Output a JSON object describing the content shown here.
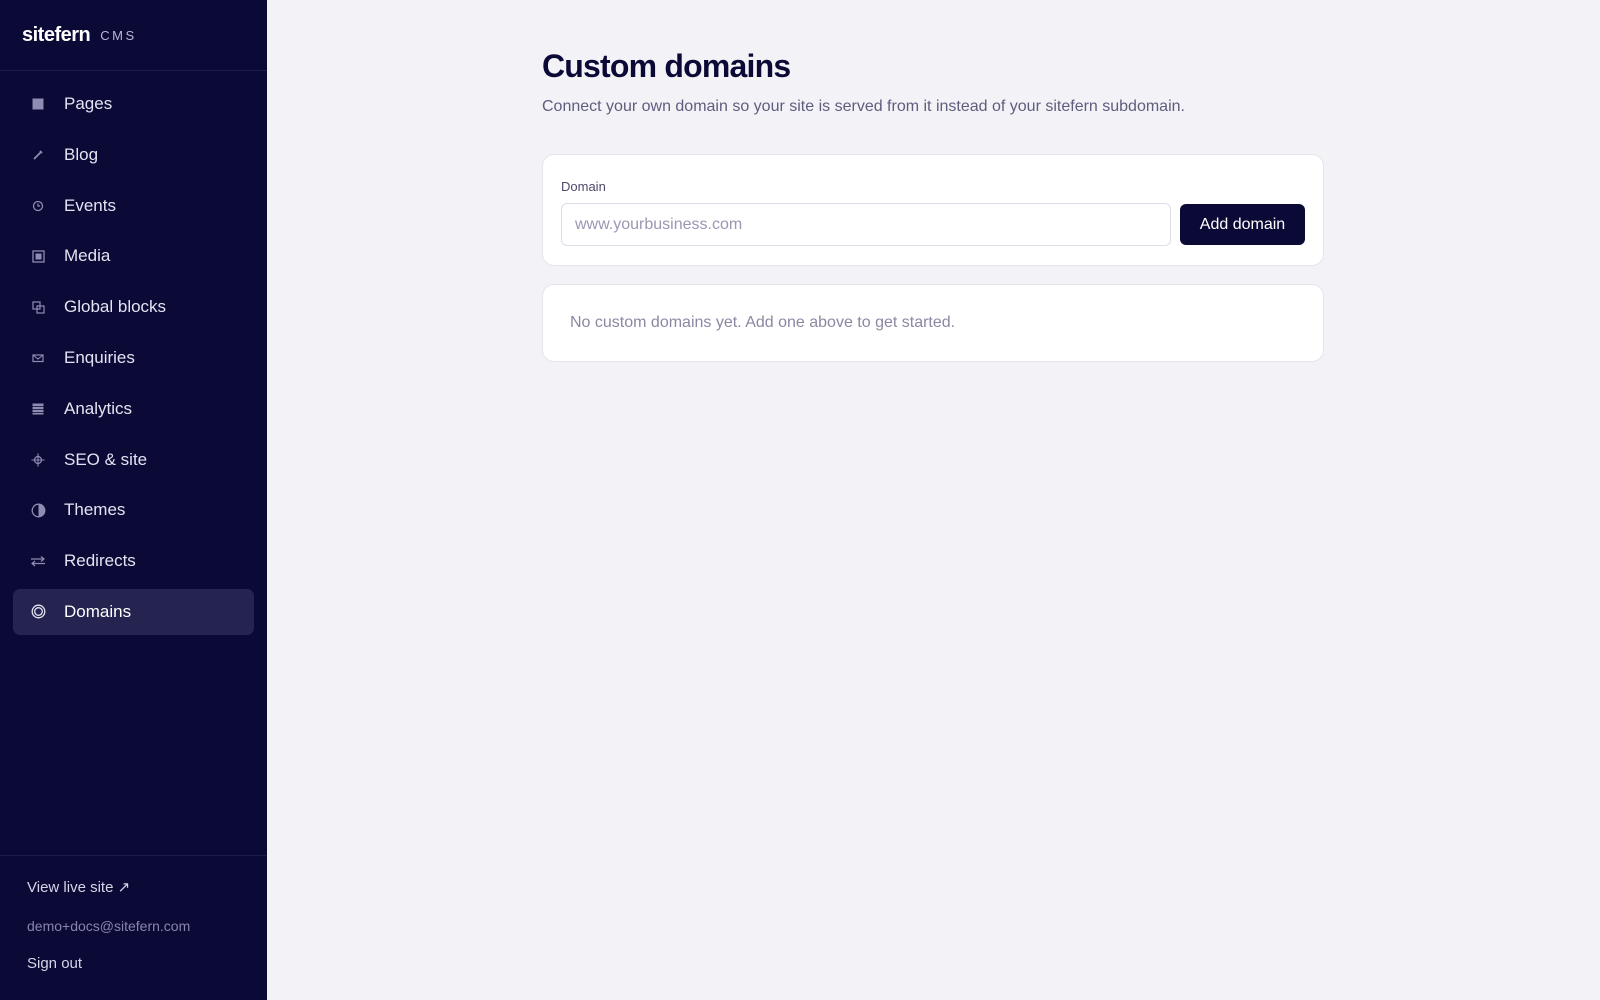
{
  "brand": {
    "name": "sitefern",
    "tag": "CMS"
  },
  "sidebar": {
    "items": [
      {
        "label": "Pages",
        "icon": "pages-icon",
        "active": false
      },
      {
        "label": "Blog",
        "icon": "pencil-icon",
        "active": false
      },
      {
        "label": "Events",
        "icon": "clock-icon",
        "active": false
      },
      {
        "label": "Media",
        "icon": "image-icon",
        "active": false
      },
      {
        "label": "Global blocks",
        "icon": "blocks-icon",
        "active": false
      },
      {
        "label": "Enquiries",
        "icon": "envelope-icon",
        "active": false
      },
      {
        "label": "Analytics",
        "icon": "bar-chart-icon",
        "active": false
      },
      {
        "label": "SEO & site",
        "icon": "crosshair-icon",
        "active": false
      },
      {
        "label": "Themes",
        "icon": "half-circle-icon",
        "active": false
      },
      {
        "label": "Redirects",
        "icon": "arrows-swap-icon",
        "active": false
      },
      {
        "label": "Domains",
        "icon": "globe-ring-icon",
        "active": true
      }
    ],
    "footer": {
      "view_live": "View live site ↗",
      "email": "demo+docs@sitefern.com",
      "sign_out": "Sign out"
    }
  },
  "main": {
    "title": "Custom domains",
    "subtitle": "Connect your own domain so your site is served from it instead of your sitefern subdomain.",
    "form": {
      "label": "Domain",
      "placeholder": "www.yourbusiness.com",
      "value": "",
      "button": "Add domain"
    },
    "empty_message": "No custom domains yet. Add one above to get started."
  },
  "colors": {
    "sidebar_bg": "#0b0936",
    "active_item_bg": "#25234f",
    "page_bg": "#f3f2f7",
    "primary_button": "#0b0936"
  }
}
